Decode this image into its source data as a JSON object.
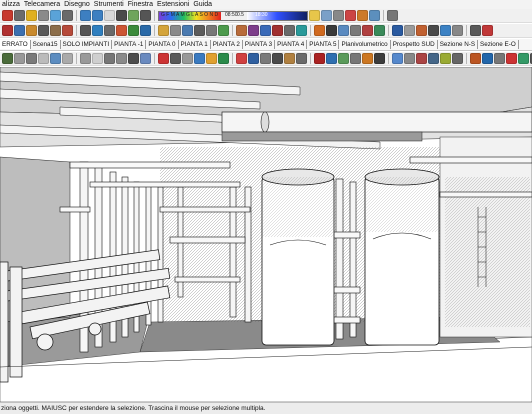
{
  "menu": [
    "alizza",
    "Telecamera",
    "Disegno",
    "Strumenti",
    "Finestra",
    "Estensioni",
    "Guida"
  ],
  "toolbar_colors": {
    "row1": [
      "#c73a2e",
      "#6b6b6b",
      "#e0b020",
      "#8a8a8a",
      "#5aa3d8",
      "#6a6a6a",
      "#3d7fc1",
      "#3d7fc1",
      "#d8d8d8",
      "#4a4a4a",
      "#6fa55c",
      "#555555",
      "#e7c64a",
      "#7aa0c8",
      "#888888",
      "#c44",
      "#cc7a2a",
      "#5c8fbd",
      "#777777"
    ],
    "row2": [
      "#b03030",
      "#3b6fb0",
      "#c98a2e",
      "#5a5a5a",
      "#8c6e4a",
      "#b64a3a",
      "#555555",
      "#2f7fbf",
      "#6a6a6a",
      "#cc5533",
      "#3a8a3a",
      "#2a6aa8",
      "#d4a43a",
      "#8a8a8a",
      "#4a7ab0",
      "#5c5c5c",
      "#777777",
      "#4c9a4c",
      "#b86b3a",
      "#7d3d8a",
      "#3a6ab8",
      "#a03030",
      "#6a6a6a",
      "#2a9a9a",
      "#d06a20",
      "#3a3a3a",
      "#5a8ac0",
      "#7a7a7a",
      "#b04040",
      "#3a8a5a",
      "#2a5aa0",
      "#9a9a9a",
      "#c06030",
      "#4a4a4a",
      "#3c82c4",
      "#888888",
      "#5a5a5a",
      "#c03838"
    ],
    "row3": [
      "#4a6b3a",
      "#999999",
      "#7a7a7a",
      "#bbbbbb",
      "#5b8cc0",
      "#aaaaaa",
      "#999999",
      "#cfcfcf",
      "#777777",
      "#8a8a8a",
      "#4c4c4c",
      "#6a8abf",
      "#cc3333",
      "#5a5a5a",
      "#999999",
      "#3a7ac0",
      "#e0a030",
      "#2a8a4a",
      "#d04040",
      "#3060a0",
      "#7a7a7a",
      "#4b4b4b",
      "#b08040",
      "#6a6a6a",
      "#aa2222",
      "#2f6fb0",
      "#5a9a5a",
      "#777777",
      "#cc7722",
      "#3c3c3c",
      "#5588cc",
      "#888888",
      "#aa4444",
      "#446688",
      "#99aa33",
      "#666666",
      "#bb5522",
      "#2266aa",
      "#777777",
      "#cc3333",
      "#339966",
      "#555555",
      "#3388cc",
      "#aa6622",
      "#666666",
      "#993333",
      "#4477bb"
    ]
  },
  "color_strip": {
    "label_left": "G  F M A M G L A S O N D",
    "label_mid_a": "08:50",
    "label_mid_b": "0.5",
    "label_mid_c": "18:30"
  },
  "scenes": [
    "ERRATO",
    "Scena15",
    "SOLO IMPIANTI",
    "PIANTA -1",
    "PIANTA 0",
    "PIANTA 1",
    "PIANTA 2",
    "PIANTA 3",
    "PIANTA 4",
    "PIANTA 5",
    "Planivolumetrico",
    "Prospetto SUD",
    "Sezione N-S",
    "Sezione E-O"
  ],
  "active_scene": "ERRATO",
  "status": "ziona oggetti. MAIUSC per estendere la selezione. Trascina il mouse per selezione multipla."
}
